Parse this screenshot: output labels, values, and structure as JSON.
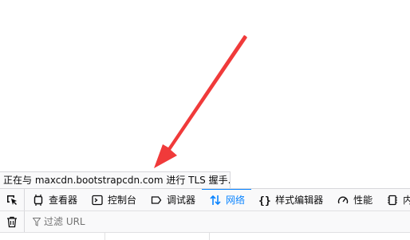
{
  "status_bar": {
    "text": "正在与 maxcdn.bootstrapcdn.com 进行 TLS 握手..."
  },
  "devtools": {
    "tabs": [
      {
        "label": "查看器",
        "icon": "inspector-icon"
      },
      {
        "label": "控制台",
        "icon": "console-icon"
      },
      {
        "label": "调试器",
        "icon": "debugger-icon"
      },
      {
        "label": "网络",
        "icon": "network-icon",
        "active": true
      },
      {
        "label": "样式编辑器",
        "icon": "style-editor-icon"
      },
      {
        "label": "性能",
        "icon": "performance-icon"
      },
      {
        "label": "内",
        "icon": "memory-icon"
      }
    ],
    "filter_placeholder": "过滤 URL"
  },
  "colors": {
    "annotation_arrow": "#f03a3a",
    "active_tab": "#0a84ff"
  }
}
